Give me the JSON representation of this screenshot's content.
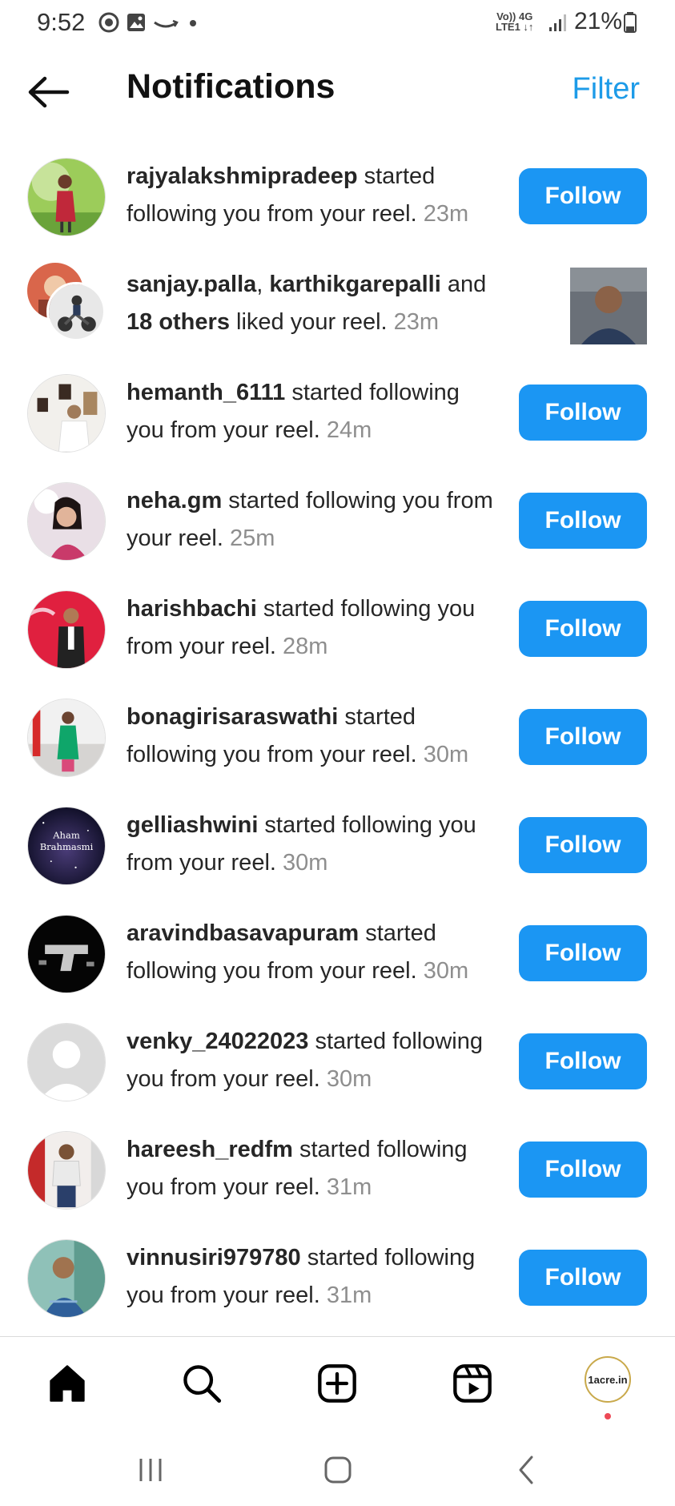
{
  "status_bar": {
    "time": "9:52",
    "network_top": "Vo)) 4G",
    "network_bottom": "LTE1 ↓↑",
    "battery": "21%"
  },
  "header": {
    "title": "Notifications",
    "filter_label": "Filter",
    "back_icon": "arrow-left-icon"
  },
  "notifications": [
    {
      "user": "rajyalakshmipradeep",
      "text": " started following you from your reel.",
      "time": "23m",
      "action": "Follow"
    },
    {
      "user": "sanjay.palla",
      "sep": ", ",
      "user2": "karthikgarepalli",
      "mid": " and ",
      "others": "18 others",
      "text": " liked your reel.",
      "time": "23m"
    },
    {
      "user": "hemanth_6111",
      "text": " started following you from your reel.",
      "time": "24m",
      "action": "Follow"
    },
    {
      "user": "neha.gm",
      "text": " started following you from your reel.",
      "time": "25m",
      "action": "Follow"
    },
    {
      "user": "harishbachi",
      "text": " started following you from your reel.",
      "time": "28m",
      "action": "Follow"
    },
    {
      "user": "bonagirisaraswathi",
      "text": " started following you from your reel.",
      "time": "30m",
      "action": "Follow"
    },
    {
      "user": "gelliashwini",
      "text": " started following you from your reel.",
      "time": "30m",
      "action": "Follow",
      "avatar_text_1": "Aham",
      "avatar_text_2": "Brahmasmi"
    },
    {
      "user": "aravindbasavapuram",
      "text": " started following you from your reel.",
      "time": "30m",
      "action": "Follow"
    },
    {
      "user": "venky_24022023",
      "text": " started following you from your reel.",
      "time": "30m",
      "action": "Follow"
    },
    {
      "user": "hareesh_redfm",
      "text": " started following you from your reel.",
      "time": "31m",
      "action": "Follow"
    },
    {
      "user": "vinnusiri979780",
      "text": " started following you from your reel.",
      "time": "31m",
      "action": "Follow"
    }
  ],
  "bottom_nav": {
    "items": [
      "home-icon",
      "search-icon",
      "create-icon",
      "reels-icon",
      "profile-avatar"
    ],
    "profile_label": "1acre.in",
    "active_color": "#000000"
  },
  "colors": {
    "accent": "#1b96f3",
    "filter": "#1d9be8",
    "notification_dot": "#ed4956"
  }
}
